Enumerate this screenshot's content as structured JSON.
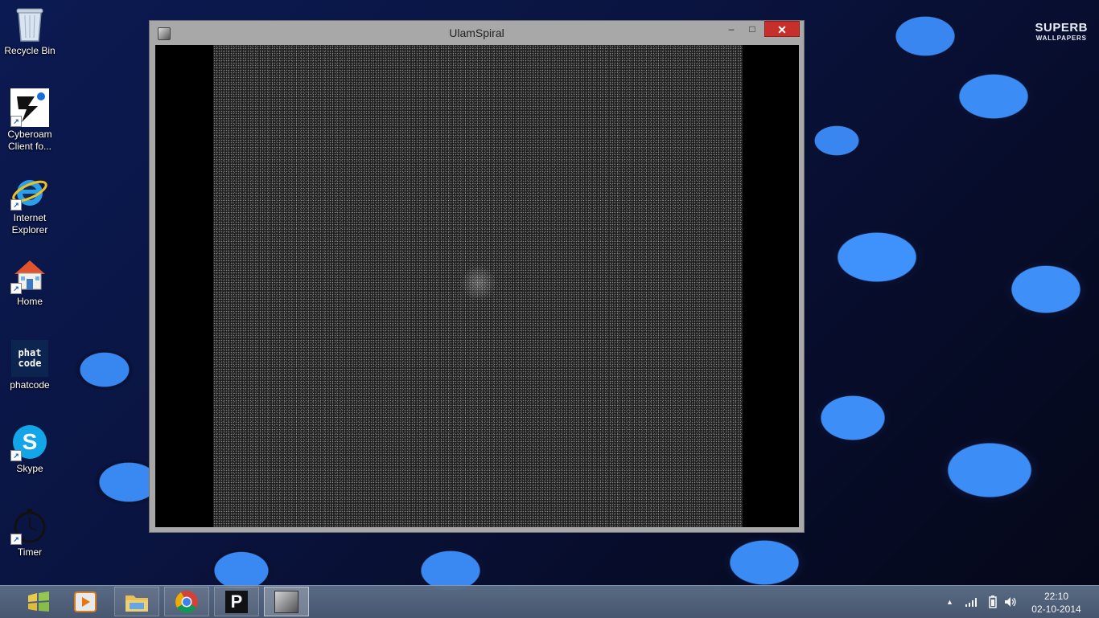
{
  "desktop": {
    "icons": [
      {
        "label": "Recycle Bin",
        "icon": "recycle-bin-icon"
      },
      {
        "label": "Cyberoam Client fo...",
        "icon": "cyberoam-icon"
      },
      {
        "label": "Internet Explorer",
        "icon": "internet-explorer-icon"
      },
      {
        "label": "Home",
        "icon": "home-icon"
      },
      {
        "label": "phatcode",
        "icon": "phatcode-icon",
        "icon_text": "phat code"
      },
      {
        "label": "Skype",
        "icon": "skype-icon",
        "icon_text": "S"
      },
      {
        "label": "Timer",
        "icon": "timer-icon"
      }
    ],
    "watermark": {
      "line1": "SUPERB",
      "line2": "WALLPAPERS"
    }
  },
  "window": {
    "title": "UlamSpiral",
    "controls": {
      "minimize": "–",
      "maximize": "□",
      "close": "✕"
    }
  },
  "taskbar": {
    "buttons": [
      {
        "name": "start-button",
        "icon": "windows-start-icon"
      },
      {
        "name": "media-player-button",
        "icon": "media-player-icon"
      },
      {
        "name": "file-explorer-button",
        "icon": "folder-icon"
      },
      {
        "name": "chrome-button",
        "icon": "chrome-icon"
      },
      {
        "name": "p-app-button",
        "icon": "p-app-icon",
        "icon_text": "P"
      },
      {
        "name": "ulamspiral-taskbar-button",
        "icon": "ulamspiral-app-icon"
      }
    ],
    "tray": {
      "show_hidden": "▲",
      "time": "22:10",
      "date": "02-10-2014"
    }
  },
  "colors": {
    "close_button": "#c7302a",
    "taskbar": "#5d6e88",
    "accent_blue": "#3a88f2"
  }
}
